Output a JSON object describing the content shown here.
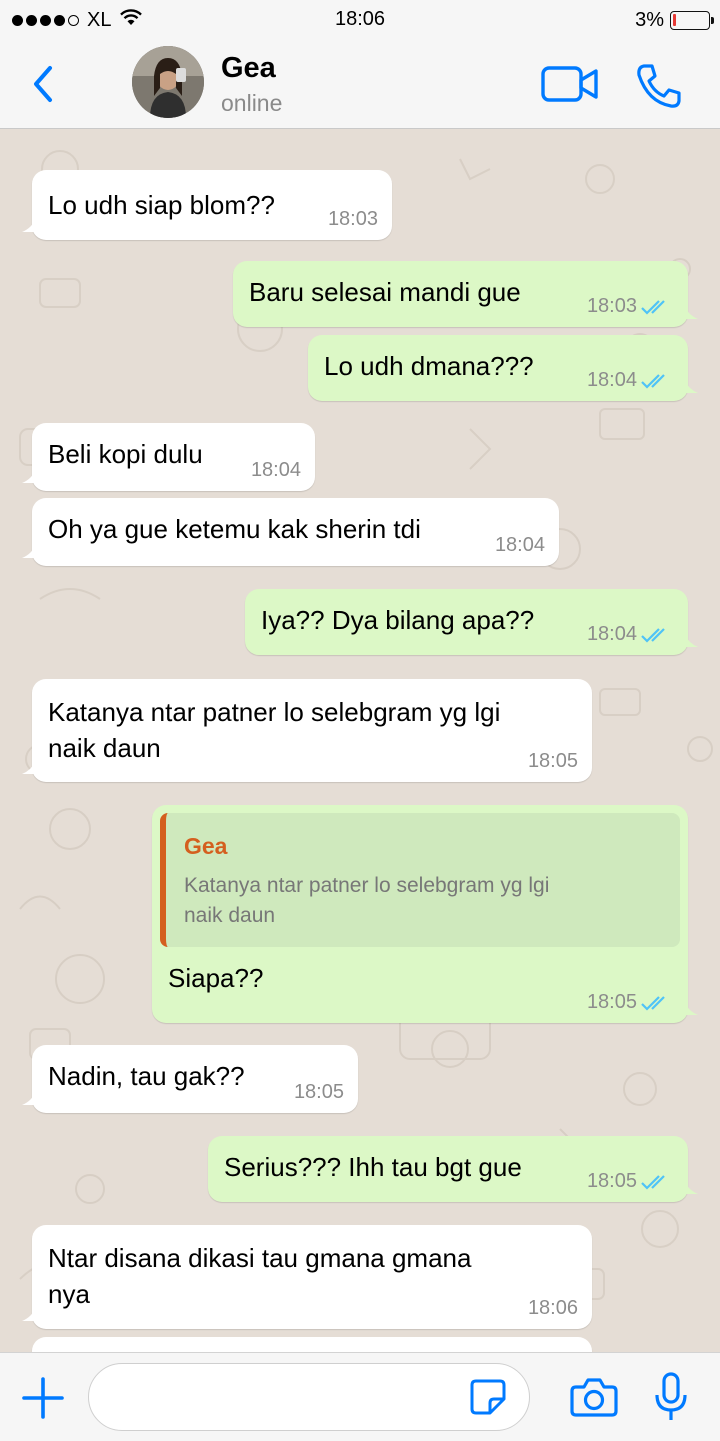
{
  "status_bar": {
    "carrier": "XL",
    "time": "18:06",
    "battery_percent": "3%",
    "battery_level": 0.03,
    "signal_bars_filled": 4
  },
  "header": {
    "contact_name": "Gea",
    "contact_status": "online",
    "icons": {
      "back": "chevron-left-icon",
      "video": "video-call-icon",
      "call": "phone-icon"
    },
    "accent_color": "#007aff"
  },
  "messages": [
    {
      "dir": "in",
      "text": "Lo udh siap blom??",
      "time": "18:03"
    },
    {
      "dir": "out",
      "text": "Baru selesai mandi gue",
      "time": "18:03",
      "status": "read"
    },
    {
      "dir": "out",
      "text": "Lo udh dmana???",
      "time": "18:04",
      "status": "read"
    },
    {
      "dir": "in",
      "text": "Beli kopi dulu",
      "time": "18:04"
    },
    {
      "dir": "in",
      "text": "Oh ya gue ketemu kak sherin tdi",
      "time": "18:04"
    },
    {
      "dir": "out",
      "text": "Iya?? Dya bilang apa??",
      "time": "18:04",
      "status": "read"
    },
    {
      "dir": "in",
      "text_line1": "Katanya ntar patner lo selebgram yg lgi",
      "text_line2": "naik daun",
      "time": "18:05"
    },
    {
      "dir": "out",
      "quote_name": "Gea",
      "quote_line1": "Katanya ntar patner lo selebgram yg lgi",
      "quote_line2": "naik daun",
      "text": "Siapa??",
      "time": "18:05",
      "status": "read"
    },
    {
      "dir": "in",
      "text": "Nadin, tau gak??",
      "time": "18:05"
    },
    {
      "dir": "out",
      "text": "Serius??? Ihh tau bgt gue",
      "time": "18:05",
      "status": "read"
    },
    {
      "dir": "in",
      "text_line1": "Ntar disana dikasi tau gmana gmana",
      "text_line2": "nya",
      "time": "18:06"
    }
  ],
  "colors": {
    "incoming_bubble": "#ffffff",
    "outgoing_bubble": "#dcf8c6",
    "read_ticks": "#4fc3f7",
    "quote_accent": "#d45f1f",
    "chat_background": "#e5ddd5"
  },
  "composer": {
    "input_value": "",
    "icons": {
      "plus": "plus-icon",
      "sticker": "sticker-icon",
      "camera": "camera-icon",
      "mic": "microphone-icon"
    }
  }
}
